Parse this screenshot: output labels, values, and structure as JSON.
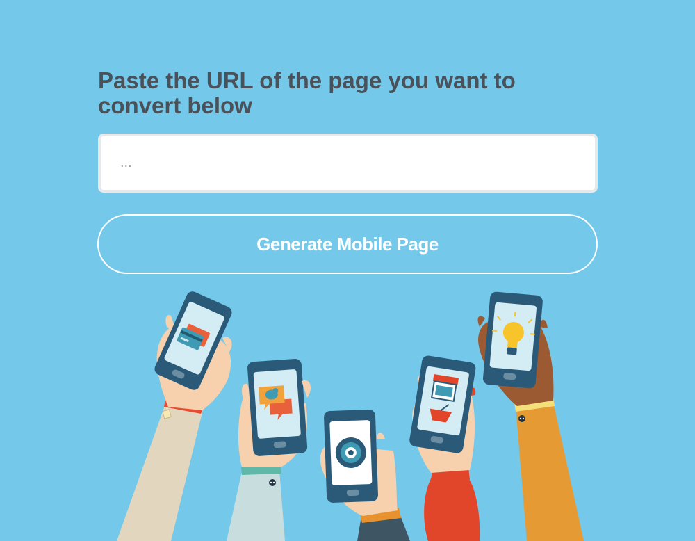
{
  "form": {
    "heading": "Paste the URL of the page you want to convert below",
    "url_placeholder": "...",
    "url_value": "",
    "generate_label": "Generate Mobile Page"
  },
  "illustration": {
    "phones": [
      {
        "screen_icon": "credit-card-icon"
      },
      {
        "screen_icon": "chat-bird-icon"
      },
      {
        "screen_icon": "globe-gear-icon"
      },
      {
        "screen_icon": "shop-basket-icon"
      },
      {
        "screen_icon": "lightbulb-icon"
      }
    ]
  },
  "colors": {
    "background": "#74c8ea",
    "heading": "#4a5159",
    "phone_body": "#2a5a78",
    "screen": "#d4ecf4"
  }
}
